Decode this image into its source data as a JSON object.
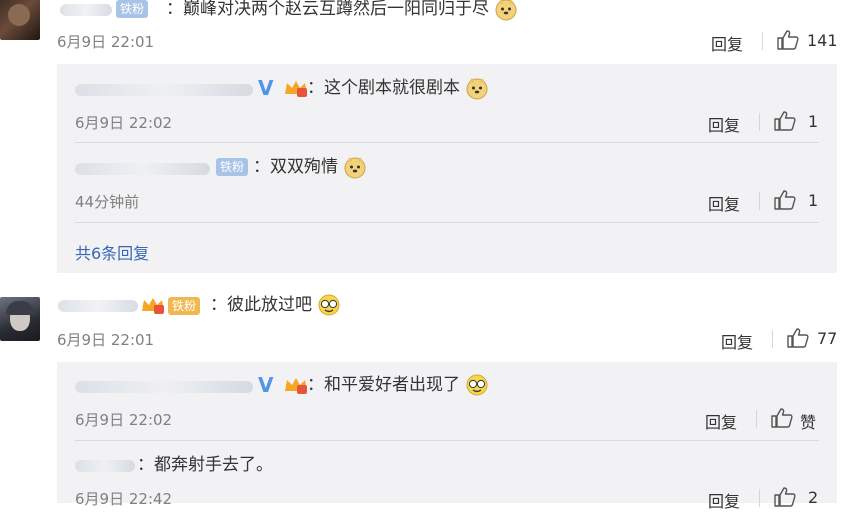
{
  "comments": [
    {
      "text": "：巅峰对决两个赵云互蹲然后一阳同归于尽",
      "badge": "铁粉",
      "time": "6月9日 22:01",
      "reply": "回复",
      "likes": "141",
      "emoji": "doge"
    },
    {
      "text": "：彼此放过吧",
      "badge": "铁粉",
      "time": "6月9日 22:01",
      "reply": "回复",
      "likes": "77",
      "emoji": "laugh-cry"
    }
  ],
  "replies_1": [
    {
      "text": "：这个剧本就很剧本",
      "time": "6月9日 22:02",
      "reply": "回复",
      "likes": "1",
      "emoji": "doge"
    },
    {
      "text": "：双双殉情",
      "badge": "铁粉",
      "time": "44分钟前",
      "reply": "回复",
      "likes": "1",
      "emoji": "doge"
    }
  ],
  "more_replies": "共6条回复",
  "replies_2": [
    {
      "text": "：和平爱好者出现了",
      "time": "6月9日 22:02",
      "reply": "回复",
      "likes": "赞",
      "emoji": "laugh-cry"
    },
    {
      "text": "：都奔射手去了。",
      "time": "6月9日 22:42",
      "reply": "回复",
      "likes": "2"
    }
  ],
  "colors": {
    "link": "#3867b3",
    "badge": "#a9c3e6",
    "vip": "#4f96e8",
    "reply_bg": "#f2f2f5"
  }
}
